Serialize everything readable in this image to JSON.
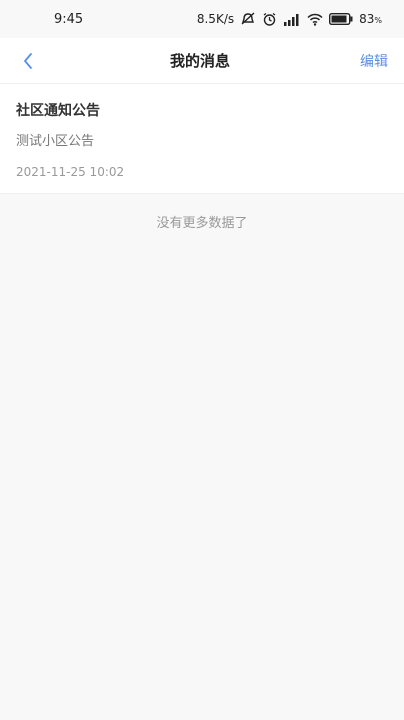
{
  "status_bar": {
    "time": "9:45",
    "network_speed": "8.5K/s",
    "battery_percent": "83",
    "battery_unit": "%",
    "icons": [
      "silent-icon",
      "alarm-icon",
      "signal-icon",
      "wifi-icon",
      "battery-icon"
    ]
  },
  "navbar": {
    "title": "我的消息",
    "edit_label": "编辑",
    "back_icon": "chevron-left-icon"
  },
  "messages": [
    {
      "title": "社区通知公告",
      "content": "测试小区公告",
      "time": "2021-11-25 10:02"
    }
  ],
  "footer": {
    "no_more_text": "没有更多数据了"
  },
  "colors": {
    "accent": "#5a8ee6",
    "background": "#f8f8f8",
    "card": "#ffffff"
  }
}
